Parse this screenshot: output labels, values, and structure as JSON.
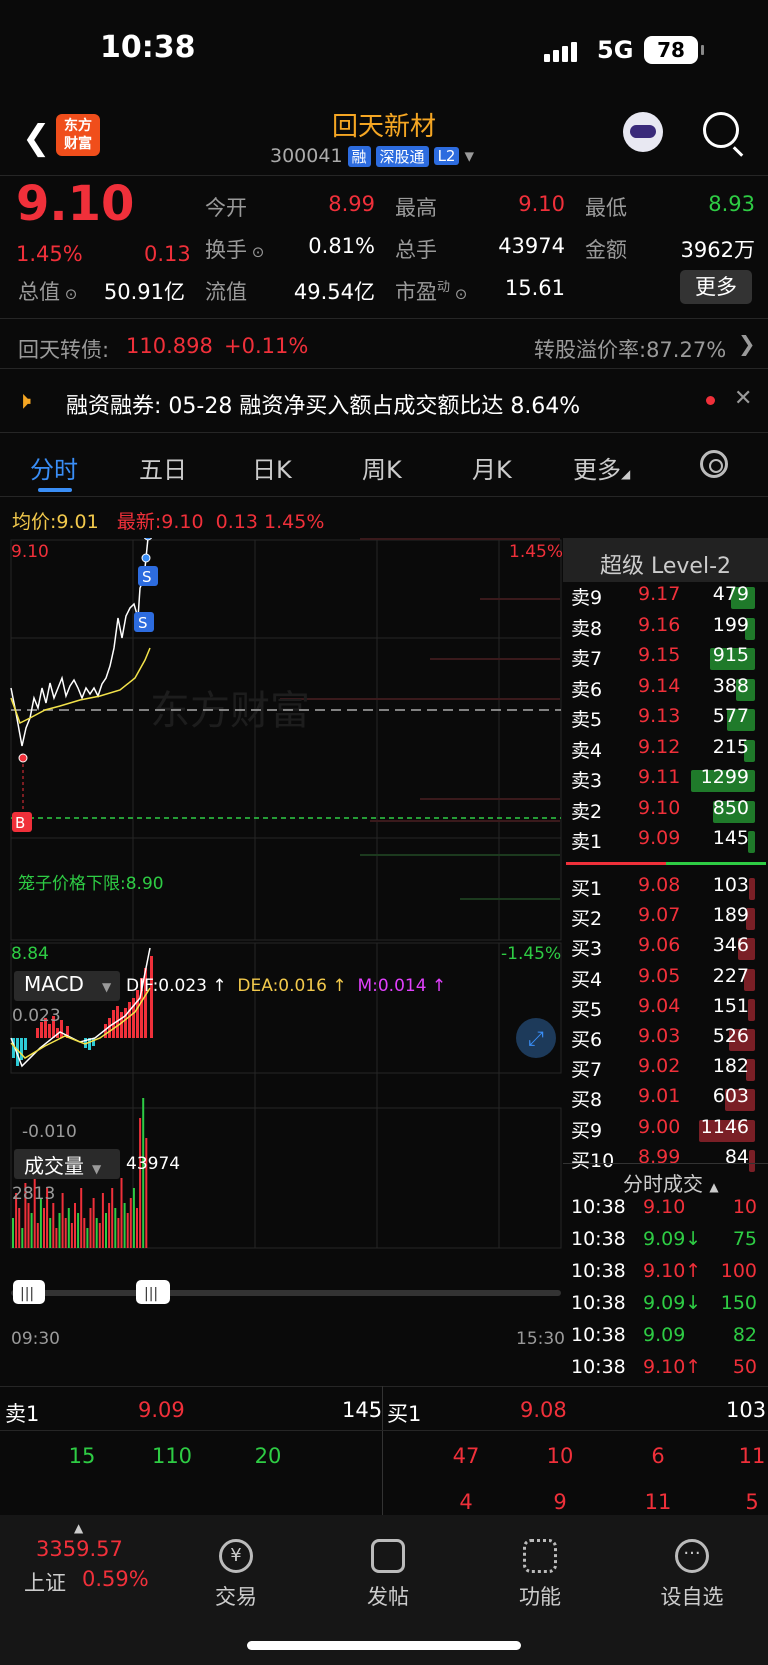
{
  "status": {
    "time": "10:38",
    "network": "5G",
    "battery": "78"
  },
  "header": {
    "name": "回天新材",
    "code": "300041",
    "tags": [
      "融",
      "深股通",
      "L2"
    ],
    "logo": [
      "东方",
      "财富"
    ]
  },
  "quote": {
    "price": "9.10",
    "pct": "1.45%",
    "chg": "0.13",
    "items": [
      {
        "label": "今开",
        "value": "8.99",
        "vcolor": "r"
      },
      {
        "label": "最高",
        "value": "9.10",
        "vcolor": "r"
      },
      {
        "label": "最低",
        "value": "8.93",
        "vcolor": "g"
      },
      {
        "label": "换手",
        "value": "0.81%",
        "vcolor": "w"
      },
      {
        "label": "总手",
        "value": "43974",
        "vcolor": "w"
      },
      {
        "label": "金额",
        "value": "3962万",
        "vcolor": "w"
      },
      {
        "label": "总值",
        "value": "50.91亿",
        "vcolor": "w"
      },
      {
        "label": "流值",
        "value": "49.54亿",
        "vcolor": "w"
      },
      {
        "label": "市盈",
        "sup": "动",
        "value": "15.61",
        "vcolor": "w"
      }
    ],
    "more": "更多"
  },
  "bond": {
    "label": "回天转债:",
    "price": "110.898",
    "chg": "+0.11%",
    "premium": "转股溢价率:87.27%"
  },
  "notice": {
    "text": "融资融券: 05-28 融资净买入额占成交额比达 8.64%"
  },
  "tabs": [
    "分时",
    "五日",
    "日K",
    "周K",
    "月K",
    "更多"
  ],
  "chart_header": {
    "avg_label": "均价:",
    "avg": "9.01",
    "latest_label": "最新:",
    "latest": "9.10",
    "chg": "0.13",
    "pct": "1.45%"
  },
  "chart": {
    "high": "9.10",
    "low": "8.84",
    "hpct": "1.45%",
    "lpct": "-1.45%",
    "limit_label": "笼子价格下限:",
    "limit": "8.90",
    "start": "09:30",
    "end": "15:30",
    "watermark": "东方财富"
  },
  "macd": {
    "name": "MACD",
    "dif": "DIF:0.023 ↑",
    "dea": "DEA:0.016 ↑",
    "m": "M:0.014 ↑",
    "top": "0.023",
    "bottom": "-0.010"
  },
  "volume": {
    "name": "成交量",
    "value": "43974",
    "top": "2813"
  },
  "level2": {
    "title": "超级 Level-2",
    "sell": [
      [
        "卖9",
        "9.17",
        "479"
      ],
      [
        "卖8",
        "9.16",
        "199"
      ],
      [
        "卖7",
        "9.15",
        "915"
      ],
      [
        "卖6",
        "9.14",
        "388"
      ],
      [
        "卖5",
        "9.13",
        "577"
      ],
      [
        "卖4",
        "9.12",
        "215"
      ],
      [
        "卖3",
        "9.11",
        "1299"
      ],
      [
        "卖2",
        "9.10",
        "850"
      ],
      [
        "卖1",
        "9.09",
        "145"
      ]
    ],
    "buy": [
      [
        "买1",
        "9.08",
        "103"
      ],
      [
        "买2",
        "9.07",
        "189"
      ],
      [
        "买3",
        "9.06",
        "346"
      ],
      [
        "买4",
        "9.05",
        "227"
      ],
      [
        "买5",
        "9.04",
        "151"
      ],
      [
        "买6",
        "9.03",
        "526"
      ],
      [
        "买7",
        "9.02",
        "182"
      ],
      [
        "买8",
        "9.01",
        "603"
      ],
      [
        "买9",
        "9.00",
        "1146"
      ],
      [
        "买10",
        "8.99",
        "84"
      ]
    ]
  },
  "trades": {
    "title": "分时成交",
    "rows": [
      [
        "10:38",
        "9.10",
        "10",
        "r",
        "r"
      ],
      [
        "10:38",
        "9.09↓",
        "75",
        "g",
        "g"
      ],
      [
        "10:38",
        "9.10↑",
        "100",
        "r",
        "r"
      ],
      [
        "10:38",
        "9.09↓",
        "150",
        "g",
        "g"
      ],
      [
        "10:38",
        "9.09",
        "82",
        "g",
        "g"
      ],
      [
        "10:38",
        "9.10↑",
        "50",
        "r",
        "r"
      ]
    ]
  },
  "queue": {
    "sell_label": "卖1",
    "sell_price": "9.09",
    "sell_vol": "145",
    "buy_label": "买1",
    "buy_price": "9.08",
    "buy_vol": "103",
    "sell_orders": [
      "15",
      "110",
      "20"
    ],
    "buy_orders_1": [
      "47",
      "10",
      "6",
      "11"
    ],
    "buy_orders_2": [
      "4",
      "9",
      "11",
      "5"
    ]
  },
  "nav": {
    "index_value": "3359.57",
    "index_name": "上证",
    "index_pct": "0.59%",
    "items": [
      "交易",
      "发帖",
      "功能",
      "设自选"
    ]
  }
}
